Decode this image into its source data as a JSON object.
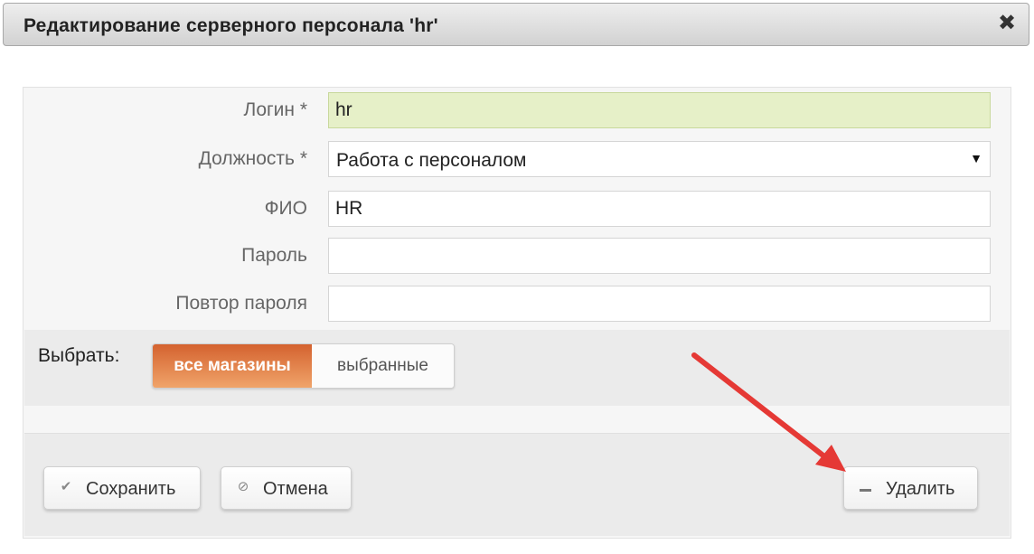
{
  "dialog": {
    "title": "Редактирование серверного персонала 'hr'",
    "close_glyph": "✖",
    "close_icon": "close-icon"
  },
  "form": {
    "login": {
      "label": "Логин *",
      "value": "hr"
    },
    "position": {
      "label": "Должность *",
      "value": "Работа с персоналом",
      "arrow": "▼"
    },
    "fullname": {
      "label": "ФИО",
      "value": "HR"
    },
    "password": {
      "label": "Пароль",
      "value": ""
    },
    "password_repeat": {
      "label": "Повтор пароля",
      "value": ""
    }
  },
  "choose": {
    "label": "Выбрать:",
    "options": [
      {
        "label": "все магазины",
        "active": true
      },
      {
        "label": "выбранные",
        "active": false
      }
    ]
  },
  "buttons": {
    "save": {
      "label": "Сохранить",
      "icon": "checkmark-icon",
      "glyph": "✔"
    },
    "cancel": {
      "label": "Отмена",
      "icon": "cancel-icon",
      "glyph": "⊘"
    },
    "delete": {
      "label": "Удалить",
      "icon": "minus-icon"
    }
  },
  "colors": {
    "active_toggle": "#e07a45",
    "login_field_bg": "#e6f0c8",
    "annotation_arrow": "#e53935"
  }
}
